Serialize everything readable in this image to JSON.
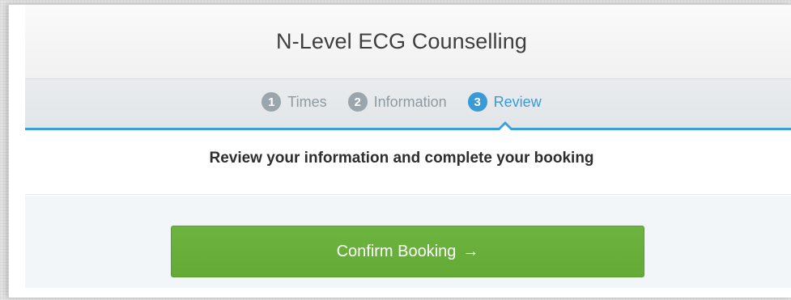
{
  "header": {
    "title": "N-Level ECG Counselling"
  },
  "steps": [
    {
      "number": "1",
      "label": "Times",
      "active": false
    },
    {
      "number": "2",
      "label": "Information",
      "active": false
    },
    {
      "number": "3",
      "label": "Review",
      "active": true
    }
  ],
  "review": {
    "heading": "Review your information and complete your booking"
  },
  "actions": {
    "confirm_label": "Confirm Booking",
    "confirm_icon": "arrow-right-icon",
    "arrow_glyph": "→"
  },
  "colors": {
    "accent": "#3a9ad6",
    "confirm": "#6db33f",
    "step_inactive": "#9aa5ac"
  }
}
